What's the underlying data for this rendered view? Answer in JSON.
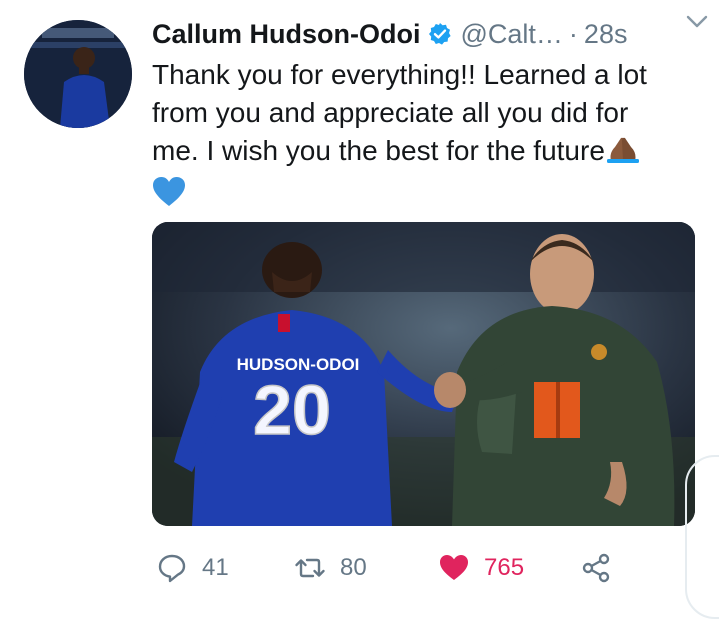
{
  "tweet": {
    "author": {
      "name": "Callum Hudson-Odoi",
      "handle": "@Calt…",
      "verified": true
    },
    "separator": "·",
    "time": "28s",
    "text_line1": "Thank you for everything!! Learned a lot",
    "text_line2": "from you and appreciate all you did for",
    "text_line3": "me. I wish you the best for the future",
    "media": {
      "jersey_name": "HUDSON-ODOI",
      "jersey_number": "20"
    },
    "stats": {
      "replies": "41",
      "retweets": "80",
      "likes": "765"
    }
  },
  "icons": {
    "caret": "chevron-down-icon",
    "reply": "reply-icon",
    "retweet": "retweet-icon",
    "like": "heart-filled-icon",
    "share": "share-icon"
  },
  "colors": {
    "text": "#14171a",
    "muted": "#657786",
    "verified_blue": "#1da1f2",
    "like_red": "#e0245e"
  }
}
